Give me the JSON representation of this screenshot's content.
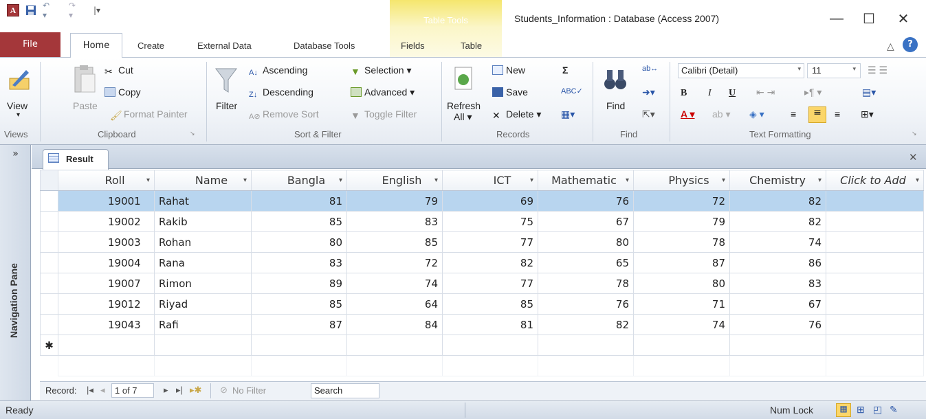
{
  "window": {
    "title": "Students_Information : Database (Access 2007)",
    "context_tab": "Table Tools",
    "minimize": "—",
    "maximize": "☐",
    "close": "✕"
  },
  "tabs": [
    "File",
    "Home",
    "Create",
    "External Data",
    "Database Tools",
    "Fields",
    "Table"
  ],
  "ribbon": {
    "views": {
      "label": "Views",
      "view": "View"
    },
    "clipboard": {
      "label": "Clipboard",
      "paste": "Paste",
      "cut": "Cut",
      "copy": "Copy",
      "format_painter": "Format Painter"
    },
    "sort_filter": {
      "label": "Sort & Filter",
      "filter": "Filter",
      "ascending": "Ascending",
      "descending": "Descending",
      "remove_sort": "Remove Sort",
      "selection": "Selection ▾",
      "advanced": "Advanced ▾",
      "toggle_filter": "Toggle Filter"
    },
    "records": {
      "label": "Records",
      "refresh": "Refresh",
      "refresh_all": "All ▾",
      "new": "New",
      "save": "Save",
      "delete": "Delete ▾"
    },
    "find": {
      "label": "Find",
      "find": "Find"
    },
    "text_formatting": {
      "label": "Text Formatting",
      "font": "Calibri (Detail)",
      "size": "11"
    }
  },
  "document": {
    "tab": "Result"
  },
  "navigation_pane": {
    "label": "Navigation Pane",
    "toggle": "»"
  },
  "table": {
    "columns": [
      "Roll",
      "Name",
      "Bangla",
      "English",
      "ICT",
      "Mathematic",
      "Physics",
      "Chemistry",
      "Click to Add"
    ],
    "rows": [
      [
        "19001",
        "Rahat",
        "81",
        "79",
        "69",
        "76",
        "72",
        "82"
      ],
      [
        "19002",
        "Rakib",
        "85",
        "83",
        "75",
        "67",
        "79",
        "82"
      ],
      [
        "19003",
        "Rohan",
        "80",
        "85",
        "77",
        "80",
        "78",
        "74"
      ],
      [
        "19004",
        "Rana",
        "83",
        "72",
        "82",
        "65",
        "87",
        "86"
      ],
      [
        "19007",
        "Rimon",
        "89",
        "74",
        "77",
        "78",
        "80",
        "83"
      ],
      [
        "19012",
        "Riyad",
        "85",
        "64",
        "85",
        "76",
        "71",
        "67"
      ],
      [
        "19043",
        "Rafi",
        "87",
        "84",
        "81",
        "82",
        "74",
        "76"
      ]
    ],
    "new_row_marker": "✱"
  },
  "record_nav": {
    "label": "Record:",
    "position": "1 of 7",
    "filter": "No Filter",
    "search": "Search"
  },
  "status": {
    "left": "Ready",
    "num_lock": "Num Lock"
  },
  "colors": {
    "file_tab": "#a4373a",
    "selected_row": "#b8d5ef",
    "table_tools": "#f5e66e"
  }
}
